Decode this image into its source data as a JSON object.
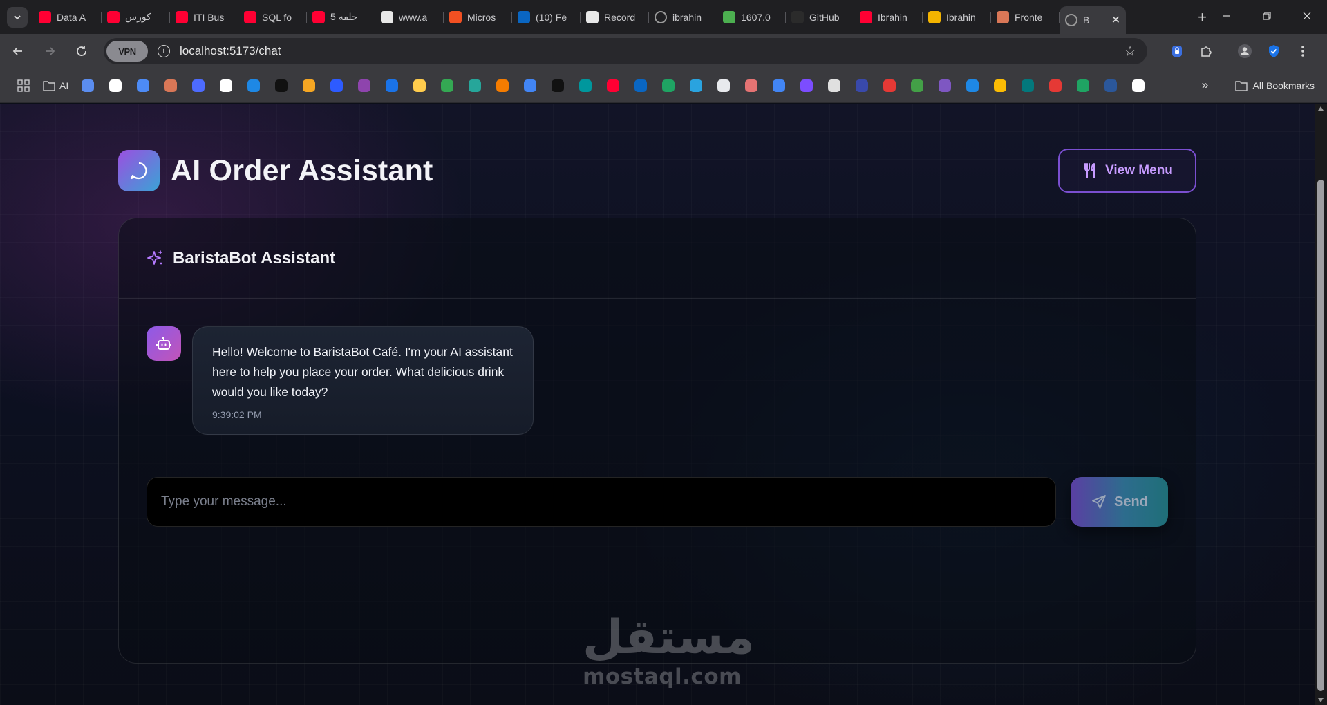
{
  "browser": {
    "tabs": [
      {
        "title": "Data A",
        "favicon": "youtube-icon",
        "color": "#ff0033"
      },
      {
        "title": "كورس",
        "favicon": "youtube-icon",
        "color": "#ff0033"
      },
      {
        "title": "ITI Bus",
        "favicon": "youtube-icon",
        "color": "#ff0033"
      },
      {
        "title": "SQL fo",
        "favicon": "youtube-icon",
        "color": "#ff0033"
      },
      {
        "title": "5 حلقه",
        "favicon": "youtube-icon",
        "color": "#ff0033"
      },
      {
        "title": "www.a",
        "favicon": "avatar-icon",
        "color": "#e8e8e8"
      },
      {
        "title": "Micros",
        "favicon": "microsoft-icon",
        "color": "#f25022"
      },
      {
        "title": "(10) Fe",
        "favicon": "linkedin-icon",
        "color": "#0a66c2"
      },
      {
        "title": "Record",
        "favicon": "avatar-icon",
        "color": "#e8e8e8"
      },
      {
        "title": "ibrahin",
        "favicon": "globe-icon",
        "color": "#9a9a9a"
      },
      {
        "title": "1607.0",
        "favicon": "smiley-icon",
        "color": "#4caf50"
      },
      {
        "title": "GitHub",
        "favicon": "github-icon",
        "color": "#2b2b2b"
      },
      {
        "title": "Ibrahin",
        "favicon": "youtube-icon",
        "color": "#ff0033"
      },
      {
        "title": "Ibrahin",
        "favicon": "slides-icon",
        "color": "#f4b400"
      },
      {
        "title": "Fronte",
        "favicon": "claude-icon",
        "color": "#d97757"
      },
      {
        "title": "B",
        "favicon": "globe-icon",
        "color": "#9a9a9a",
        "active": true
      }
    ],
    "url": "localhost:5173/chat",
    "vpn_label": "VPN",
    "bookmarks_folder": "AI",
    "all_bookmarks": "All Bookmarks",
    "bookmark_icons": [
      {
        "name": "grid-icon",
        "color": "#9aa0a6"
      },
      {
        "name": "folder-icon",
        "color": "#c9c9cc"
      },
      {
        "name": "lens-icon",
        "color": "#5b8def"
      },
      {
        "name": "openai-icon",
        "color": "#ffffff"
      },
      {
        "name": "gemini-icon",
        "color": "#4d8bf5"
      },
      {
        "name": "claude-icon",
        "color": "#d97757"
      },
      {
        "name": "deepseek-icon",
        "color": "#4d6bfe"
      },
      {
        "name": "github-icon",
        "color": "#ffffff"
      },
      {
        "name": "k-icon",
        "color": "#1e88e5"
      },
      {
        "name": "upwork-icon",
        "color": "#111111"
      },
      {
        "name": "coursera-icon",
        "color": "#f5a623"
      },
      {
        "name": "s-icon",
        "color": "#2d5bff"
      },
      {
        "name": "u-icon",
        "color": "#8e44ad"
      },
      {
        "name": "c-icon",
        "color": "#1a73e8"
      },
      {
        "name": "huggingface-icon",
        "color": "#ffcc4d"
      },
      {
        "name": "maps-icon",
        "color": "#34a853"
      },
      {
        "name": "diamond-icon",
        "color": "#26a69a"
      },
      {
        "name": "arrow-icon",
        "color": "#f57c00"
      },
      {
        "name": "translate-icon",
        "color": "#4285f4"
      },
      {
        "name": "play-icon",
        "color": "#111111"
      },
      {
        "name": "arduino-icon",
        "color": "#00979d"
      },
      {
        "name": "youtube-icon",
        "color": "#ff0033"
      },
      {
        "name": "linkedin-icon",
        "color": "#0a66c2"
      },
      {
        "name": "drive-icon",
        "color": "#1fa463"
      },
      {
        "name": "telegram-icon",
        "color": "#2aa3df"
      },
      {
        "name": "doc-icon",
        "color": "#e8eaed"
      },
      {
        "name": "flask-icon",
        "color": "#e57373"
      },
      {
        "name": "calendar-icon",
        "color": "#4285f4"
      },
      {
        "name": "spiral-icon",
        "color": "#7c4dff"
      },
      {
        "name": "qr-icon",
        "color": "#e0e0e0"
      },
      {
        "name": "w-icon",
        "color": "#3949ab"
      },
      {
        "name": "huawei-icon",
        "color": "#e53935"
      },
      {
        "name": "wuzzuf-icon",
        "color": "#43a047"
      },
      {
        "name": "copilot-icon",
        "color": "#7e57c2"
      },
      {
        "name": "onedrive-icon",
        "color": "#1e88e5"
      },
      {
        "name": "photos-icon",
        "color": "#fbbc04"
      },
      {
        "name": "sharepoint-icon",
        "color": "#03787c"
      },
      {
        "name": "nike-icon",
        "color": "#e53935"
      },
      {
        "name": "drive2-icon",
        "color": "#1fa463"
      },
      {
        "name": "word-icon",
        "color": "#2b579a"
      },
      {
        "name": "football-icon",
        "color": "#ffffff"
      }
    ]
  },
  "page": {
    "title": "AI Order Assistant",
    "view_menu_label": "View Menu",
    "assistant_name": "BaristaBot Assistant",
    "messages": [
      {
        "sender": "bot",
        "text": "Hello! Welcome to BaristaBot Café. I'm your AI assistant here to help you place your order. What delicious drink would you like today?",
        "time": "9:39:02 PM"
      }
    ],
    "input_placeholder": "Type your message...",
    "send_label": "Send",
    "accent_color": "#8b5cf6"
  },
  "watermark": {
    "arabic": "مستقل",
    "latin": "mostaql.com"
  }
}
